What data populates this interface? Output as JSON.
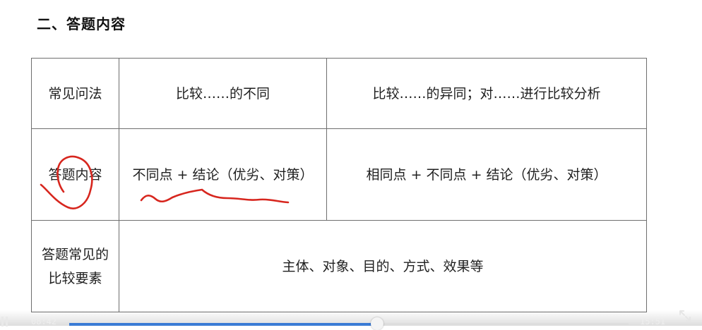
{
  "heading": "二、答题内容",
  "table": {
    "rows": [
      {
        "label": "常见问法",
        "col2": "比较……的不同",
        "col3": "比较……的异同；对……进行比较分析"
      },
      {
        "label": "答题内容",
        "col2": "不同点 + 结论（优劣、对策）",
        "col3": "相同点 + 不同点 + 结论（优劣、对策）"
      },
      {
        "label_line1": "答题常见的",
        "label_line2": "比较要素",
        "merged": "主体、对象、目的、方式、效果等"
      }
    ]
  },
  "annotation": {
    "color": "#d7261e"
  },
  "player": {
    "current_time": "08:42",
    "total_time": "15:51",
    "progress": 0.55,
    "accent": "#3a7bd5",
    "play_icon": "pause-icon",
    "fullscreen_icon": "fullscreen-icon"
  }
}
